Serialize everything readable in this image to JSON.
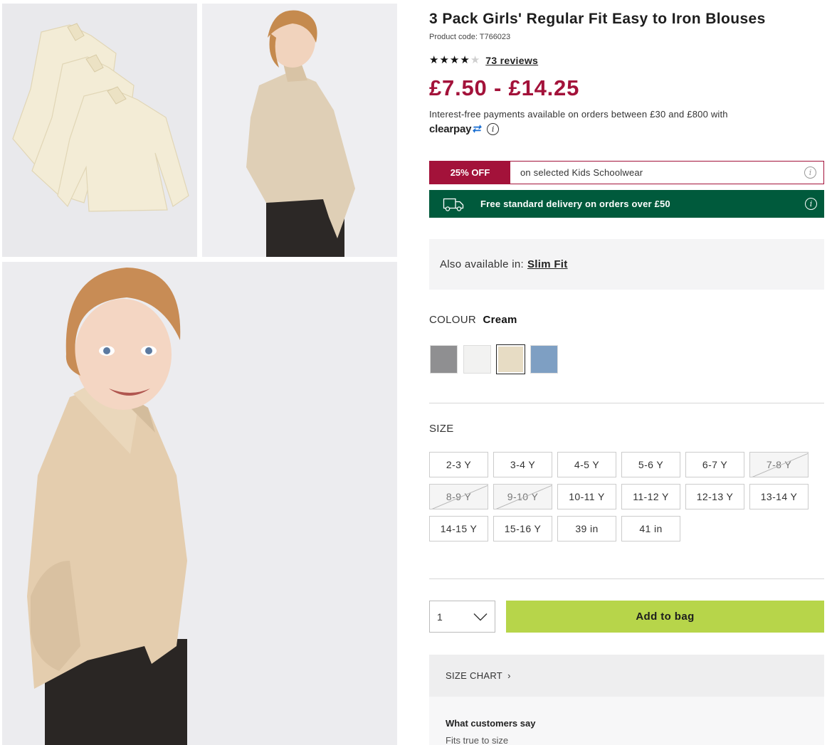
{
  "product": {
    "title": "3 Pack Girls' Regular Fit Easy to Iron Blouses",
    "code_label": "Product code:",
    "code": "T766023",
    "rating_stars": 4,
    "reviews_label": "73 reviews",
    "price": "£7.50 - £14.25",
    "price_color": "#a3123a"
  },
  "payments": {
    "text": "Interest-free payments available on orders between £30 and £800 with",
    "provider": "clearpay"
  },
  "promo": {
    "badge": "25% OFF",
    "text": "on selected Kids Schoolwear",
    "color": "#a3123a"
  },
  "delivery": {
    "text": "Free standard delivery on orders over £50",
    "color": "#005a3c"
  },
  "also_available": {
    "label": "Also available in:",
    "link": "Slim Fit"
  },
  "colour": {
    "label": "COLOUR",
    "selected": "Cream",
    "swatches": [
      "#8f8f91",
      "#f2f2f1",
      "#e7dcc4",
      "#7e9fc3"
    ],
    "selected_index": 2
  },
  "size": {
    "label": "SIZE",
    "options": [
      {
        "label": "2-3 Y",
        "available": true
      },
      {
        "label": "3-4 Y",
        "available": true
      },
      {
        "label": "4-5 Y",
        "available": true
      },
      {
        "label": "5-6 Y",
        "available": true
      },
      {
        "label": "6-7 Y",
        "available": true
      },
      {
        "label": "7-8 Y",
        "available": false
      },
      {
        "label": "8-9 Y",
        "available": false
      },
      {
        "label": "9-10 Y",
        "available": false
      },
      {
        "label": "10-11 Y",
        "available": true
      },
      {
        "label": "11-12 Y",
        "available": true
      },
      {
        "label": "12-13 Y",
        "available": true
      },
      {
        "label": "13-14 Y",
        "available": true
      },
      {
        "label": "14-15 Y",
        "available": true
      },
      {
        "label": "15-16 Y",
        "available": true
      },
      {
        "label": "39 in",
        "available": true
      },
      {
        "label": "41 in",
        "available": true
      }
    ]
  },
  "cart": {
    "quantity": "1",
    "add_label": "Add to bag",
    "button_color": "#b7d54a"
  },
  "size_chart": {
    "label": "SIZE CHART"
  },
  "customers": {
    "title": "What customers say",
    "summary": "Fits true to size"
  },
  "icons": [
    "star-icon",
    "info-icon",
    "truck-icon",
    "chevron-down-icon",
    "chevron-right-icon"
  ]
}
